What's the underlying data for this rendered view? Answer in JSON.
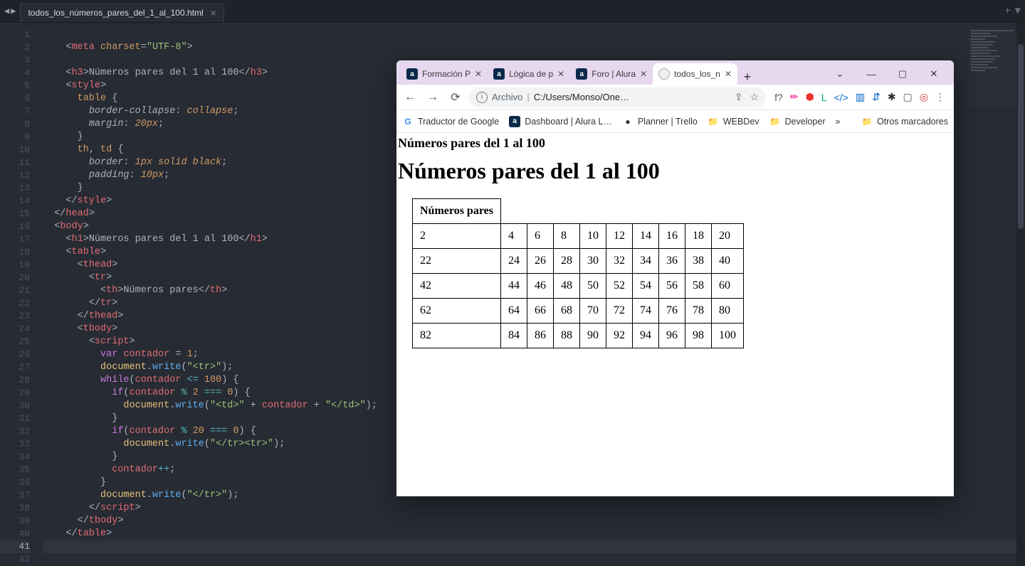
{
  "editor": {
    "nav": {
      "back": "◀",
      "fwd": "▶"
    },
    "filename": "todos_los_números_pares_del_1_al_100.html",
    "actions": {
      "add": "+",
      "menu": "▼"
    },
    "line_count": 42,
    "current_line": 41
  },
  "code_lines": [
    {
      "n": 1,
      "seg": []
    },
    {
      "n": 2,
      "seg": [
        [
          "    ",
          ""
        ],
        [
          "<",
          "t-punc"
        ],
        [
          "meta",
          "t-tag"
        ],
        [
          " ",
          ""
        ],
        [
          "charset",
          "t-attr"
        ],
        [
          "=",
          "t-punc"
        ],
        [
          "\"UTF-8\"",
          "t-str"
        ],
        [
          ">",
          "t-punc"
        ]
      ]
    },
    {
      "n": 3,
      "seg": []
    },
    {
      "n": 4,
      "seg": [
        [
          "    ",
          ""
        ],
        [
          "<",
          "t-punc"
        ],
        [
          "h3",
          "t-tag"
        ],
        [
          ">",
          "t-punc"
        ],
        [
          "Números pares del 1 al 100",
          "t-text"
        ],
        [
          "</",
          "t-punc"
        ],
        [
          "h3",
          "t-tag"
        ],
        [
          ">",
          "t-punc"
        ]
      ]
    },
    {
      "n": 5,
      "seg": [
        [
          "    ",
          ""
        ],
        [
          "<",
          "t-punc"
        ],
        [
          "style",
          "t-tag"
        ],
        [
          ">",
          "t-punc"
        ]
      ]
    },
    {
      "n": 6,
      "seg": [
        [
          "      ",
          ""
        ],
        [
          "table",
          "t-csssel"
        ],
        [
          " {",
          "t-punc"
        ]
      ]
    },
    {
      "n": 7,
      "seg": [
        [
          "        ",
          ""
        ],
        [
          "border-collapse",
          "t-cssprop"
        ],
        [
          ": ",
          "t-punc"
        ],
        [
          "collapse",
          "t-cssval"
        ],
        [
          ";",
          "t-punc"
        ]
      ]
    },
    {
      "n": 8,
      "seg": [
        [
          "        ",
          ""
        ],
        [
          "margin",
          "t-cssprop"
        ],
        [
          ": ",
          "t-punc"
        ],
        [
          "20",
          "t-cssval"
        ],
        [
          "px",
          "t-cssval"
        ],
        [
          ";",
          "t-punc"
        ]
      ]
    },
    {
      "n": 9,
      "seg": [
        [
          "      }",
          "t-punc"
        ]
      ]
    },
    {
      "n": 10,
      "seg": [
        [
          "      ",
          ""
        ],
        [
          "th",
          "t-csssel"
        ],
        [
          ", ",
          "t-punc"
        ],
        [
          "td",
          "t-csssel"
        ],
        [
          " {",
          "t-punc"
        ]
      ]
    },
    {
      "n": 11,
      "seg": [
        [
          "        ",
          ""
        ],
        [
          "border",
          "t-cssprop"
        ],
        [
          ": ",
          "t-punc"
        ],
        [
          "1",
          "t-cssval"
        ],
        [
          "px solid black",
          "t-cssval"
        ],
        [
          ";",
          "t-punc"
        ]
      ]
    },
    {
      "n": 12,
      "seg": [
        [
          "        ",
          ""
        ],
        [
          "padding",
          "t-cssprop"
        ],
        [
          ": ",
          "t-punc"
        ],
        [
          "10",
          "t-cssval"
        ],
        [
          "px",
          "t-cssval"
        ],
        [
          ";",
          "t-punc"
        ]
      ]
    },
    {
      "n": 13,
      "seg": [
        [
          "      }",
          "t-punc"
        ]
      ]
    },
    {
      "n": 14,
      "seg": [
        [
          "    ",
          ""
        ],
        [
          "</",
          "t-punc"
        ],
        [
          "style",
          "t-tag"
        ],
        [
          ">",
          "t-punc"
        ]
      ]
    },
    {
      "n": 15,
      "seg": [
        [
          "  ",
          ""
        ],
        [
          "</",
          "t-punc"
        ],
        [
          "head",
          "t-tag"
        ],
        [
          ">",
          "t-punc"
        ]
      ]
    },
    {
      "n": 16,
      "seg": [
        [
          "  ",
          ""
        ],
        [
          "<",
          "t-punc"
        ],
        [
          "body",
          "t-tag"
        ],
        [
          ">",
          "t-punc"
        ]
      ]
    },
    {
      "n": 17,
      "seg": [
        [
          "    ",
          ""
        ],
        [
          "<",
          "t-punc"
        ],
        [
          "h1",
          "t-tag"
        ],
        [
          ">",
          "t-punc"
        ],
        [
          "Números pares del 1 al 100",
          "t-text"
        ],
        [
          "</",
          "t-punc"
        ],
        [
          "h1",
          "t-tag"
        ],
        [
          ">",
          "t-punc"
        ]
      ]
    },
    {
      "n": 18,
      "seg": [
        [
          "    ",
          ""
        ],
        [
          "<",
          "t-punc"
        ],
        [
          "table",
          "t-tag"
        ],
        [
          ">",
          "t-punc"
        ]
      ]
    },
    {
      "n": 19,
      "seg": [
        [
          "      ",
          ""
        ],
        [
          "<",
          "t-punc"
        ],
        [
          "thead",
          "t-tag"
        ],
        [
          ">",
          "t-punc"
        ]
      ]
    },
    {
      "n": 20,
      "seg": [
        [
          "        ",
          ""
        ],
        [
          "<",
          "t-punc"
        ],
        [
          "tr",
          "t-tag"
        ],
        [
          ">",
          "t-punc"
        ]
      ]
    },
    {
      "n": 21,
      "seg": [
        [
          "          ",
          ""
        ],
        [
          "<",
          "t-punc"
        ],
        [
          "th",
          "t-tag"
        ],
        [
          ">",
          "t-punc"
        ],
        [
          "Números pares",
          "t-text"
        ],
        [
          "</",
          "t-punc"
        ],
        [
          "th",
          "t-tag"
        ],
        [
          ">",
          "t-punc"
        ]
      ]
    },
    {
      "n": 22,
      "seg": [
        [
          "        ",
          ""
        ],
        [
          "</",
          "t-punc"
        ],
        [
          "tr",
          "t-tag"
        ],
        [
          ">",
          "t-punc"
        ]
      ]
    },
    {
      "n": 23,
      "seg": [
        [
          "      ",
          ""
        ],
        [
          "</",
          "t-punc"
        ],
        [
          "thead",
          "t-tag"
        ],
        [
          ">",
          "t-punc"
        ]
      ]
    },
    {
      "n": 24,
      "seg": [
        [
          "      ",
          ""
        ],
        [
          "<",
          "t-punc"
        ],
        [
          "tbody",
          "t-tag"
        ],
        [
          ">",
          "t-punc"
        ]
      ]
    },
    {
      "n": 25,
      "seg": [
        [
          "        ",
          ""
        ],
        [
          "<",
          "t-punc"
        ],
        [
          "script",
          "t-tag"
        ],
        [
          ">",
          "t-punc"
        ]
      ]
    },
    {
      "n": 26,
      "seg": [
        [
          "          ",
          ""
        ],
        [
          "var",
          "t-kw"
        ],
        [
          " ",
          ""
        ],
        [
          "contador",
          "t-var"
        ],
        [
          " = ",
          "t-punc"
        ],
        [
          "1",
          "t-num"
        ],
        [
          ";",
          "t-punc"
        ]
      ]
    },
    {
      "n": 27,
      "seg": [
        [
          "          ",
          ""
        ],
        [
          "document",
          "t-obj"
        ],
        [
          ".",
          "t-punc"
        ],
        [
          "write",
          "t-func"
        ],
        [
          "(",
          "t-punc"
        ],
        [
          "\"<tr>\"",
          "t-str"
        ],
        [
          ");",
          "t-punc"
        ]
      ]
    },
    {
      "n": 28,
      "seg": [
        [
          "          ",
          ""
        ],
        [
          "while",
          "t-kw"
        ],
        [
          "(",
          "t-punc"
        ],
        [
          "contador",
          "t-var"
        ],
        [
          " ",
          ""
        ],
        [
          "<=",
          "t-op"
        ],
        [
          " ",
          ""
        ],
        [
          "100",
          "t-num"
        ],
        [
          ") {",
          "t-punc"
        ]
      ]
    },
    {
      "n": 29,
      "seg": [
        [
          "            ",
          ""
        ],
        [
          "if",
          "t-kw"
        ],
        [
          "(",
          "t-punc"
        ],
        [
          "contador",
          "t-var"
        ],
        [
          " ",
          ""
        ],
        [
          "%",
          "t-op"
        ],
        [
          " ",
          ""
        ],
        [
          "2",
          "t-num"
        ],
        [
          " ",
          ""
        ],
        [
          "===",
          "t-op"
        ],
        [
          " ",
          ""
        ],
        [
          "0",
          "t-num"
        ],
        [
          ") {",
          "t-punc"
        ]
      ]
    },
    {
      "n": 30,
      "seg": [
        [
          "              ",
          ""
        ],
        [
          "document",
          "t-obj"
        ],
        [
          ".",
          "t-punc"
        ],
        [
          "write",
          "t-func"
        ],
        [
          "(",
          "t-punc"
        ],
        [
          "\"<td>\"",
          "t-str"
        ],
        [
          " + ",
          "t-punc"
        ],
        [
          "contador",
          "t-var"
        ],
        [
          " + ",
          "t-punc"
        ],
        [
          "\"</td>\"",
          "t-str"
        ],
        [
          ");",
          "t-punc"
        ]
      ]
    },
    {
      "n": 31,
      "seg": [
        [
          "            }",
          "t-punc"
        ]
      ]
    },
    {
      "n": 32,
      "seg": [
        [
          "            ",
          ""
        ],
        [
          "if",
          "t-kw"
        ],
        [
          "(",
          "t-punc"
        ],
        [
          "contador",
          "t-var"
        ],
        [
          " ",
          ""
        ],
        [
          "%",
          "t-op"
        ],
        [
          " ",
          ""
        ],
        [
          "20",
          "t-num"
        ],
        [
          " ",
          ""
        ],
        [
          "===",
          "t-op"
        ],
        [
          " ",
          ""
        ],
        [
          "0",
          "t-num"
        ],
        [
          ") {",
          "t-punc"
        ]
      ]
    },
    {
      "n": 33,
      "seg": [
        [
          "              ",
          ""
        ],
        [
          "document",
          "t-obj"
        ],
        [
          ".",
          "t-punc"
        ],
        [
          "write",
          "t-func"
        ],
        [
          "(",
          "t-punc"
        ],
        [
          "\"</tr><tr>\"",
          "t-str"
        ],
        [
          ");",
          "t-punc"
        ]
      ]
    },
    {
      "n": 34,
      "seg": [
        [
          "            }",
          "t-punc"
        ]
      ]
    },
    {
      "n": 35,
      "seg": [
        [
          "            ",
          ""
        ],
        [
          "contador",
          "t-var"
        ],
        [
          "++",
          "t-op"
        ],
        [
          ";",
          "t-punc"
        ]
      ]
    },
    {
      "n": 36,
      "seg": [
        [
          "          }",
          "t-punc"
        ]
      ]
    },
    {
      "n": 37,
      "seg": [
        [
          "          ",
          ""
        ],
        [
          "document",
          "t-obj"
        ],
        [
          ".",
          "t-punc"
        ],
        [
          "write",
          "t-func"
        ],
        [
          "(",
          "t-punc"
        ],
        [
          "\"</tr>\"",
          "t-str"
        ],
        [
          ");",
          "t-punc"
        ]
      ]
    },
    {
      "n": 38,
      "seg": [
        [
          "        ",
          ""
        ],
        [
          "</",
          "t-punc"
        ],
        [
          "script",
          "t-tag"
        ],
        [
          ">",
          "t-punc"
        ]
      ]
    },
    {
      "n": 39,
      "seg": [
        [
          "      ",
          ""
        ],
        [
          "</",
          "t-punc"
        ],
        [
          "tbody",
          "t-tag"
        ],
        [
          ">",
          "t-punc"
        ]
      ]
    },
    {
      "n": 40,
      "seg": [
        [
          "    ",
          ""
        ],
        [
          "</",
          "t-punc"
        ],
        [
          "table",
          "t-tag"
        ],
        [
          ">",
          "t-punc"
        ]
      ]
    },
    {
      "n": 41,
      "seg": []
    },
    {
      "n": 42,
      "seg": []
    }
  ],
  "browser": {
    "tabs": [
      {
        "icon": "a",
        "iconClass": "dk",
        "label": "Formación P",
        "active": false
      },
      {
        "icon": "a",
        "iconClass": "dk",
        "label": "Lógica de p",
        "active": false
      },
      {
        "icon": "a",
        "iconClass": "dk",
        "label": "Foro | Alura",
        "active": false
      },
      {
        "icon": "",
        "iconClass": "",
        "label": "todos_los_n",
        "active": true
      }
    ],
    "newtab": "+",
    "winctrl": {
      "caret": "⌄",
      "min": "—",
      "max": "▢",
      "close": "✕"
    },
    "toolbar": {
      "back": "←",
      "fwd": "→",
      "reload": "⟳",
      "omni_label": "Archivo",
      "omni_sep": "|",
      "omni_url": "C:/Users/Monso/One…",
      "share": "⇪",
      "star": "☆"
    },
    "ext_icons": [
      "f?",
      "✏",
      "⬢",
      "L",
      "</>",
      "▥",
      "⇵",
      "✱",
      "▢",
      "◎",
      "⋮"
    ],
    "bookmarks": [
      {
        "icon": "G",
        "label": "Traductor de Google"
      },
      {
        "icon": "a",
        "label": "Dashboard | Alura L…"
      },
      {
        "icon": "●",
        "label": "Planner | Trello"
      },
      {
        "icon": "📁",
        "label": "WEBDev"
      },
      {
        "icon": "📁",
        "label": "Developer"
      }
    ],
    "bookmarks_overflow": "»",
    "bookmarks_other": {
      "icon": "📁",
      "label": "Otros marcadores"
    }
  },
  "page": {
    "h3": "Números pares del 1 al 100",
    "h1": "Números pares del 1 al 100",
    "table_header": "Números pares",
    "table_rows": [
      [
        2,
        4,
        6,
        8,
        10,
        12,
        14,
        16,
        18,
        20
      ],
      [
        22,
        24,
        26,
        28,
        30,
        32,
        34,
        36,
        38,
        40
      ],
      [
        42,
        44,
        46,
        48,
        50,
        52,
        54,
        56,
        58,
        60
      ],
      [
        62,
        64,
        66,
        68,
        70,
        72,
        74,
        76,
        78,
        80
      ],
      [
        82,
        84,
        86,
        88,
        90,
        92,
        94,
        96,
        98,
        100
      ]
    ]
  }
}
